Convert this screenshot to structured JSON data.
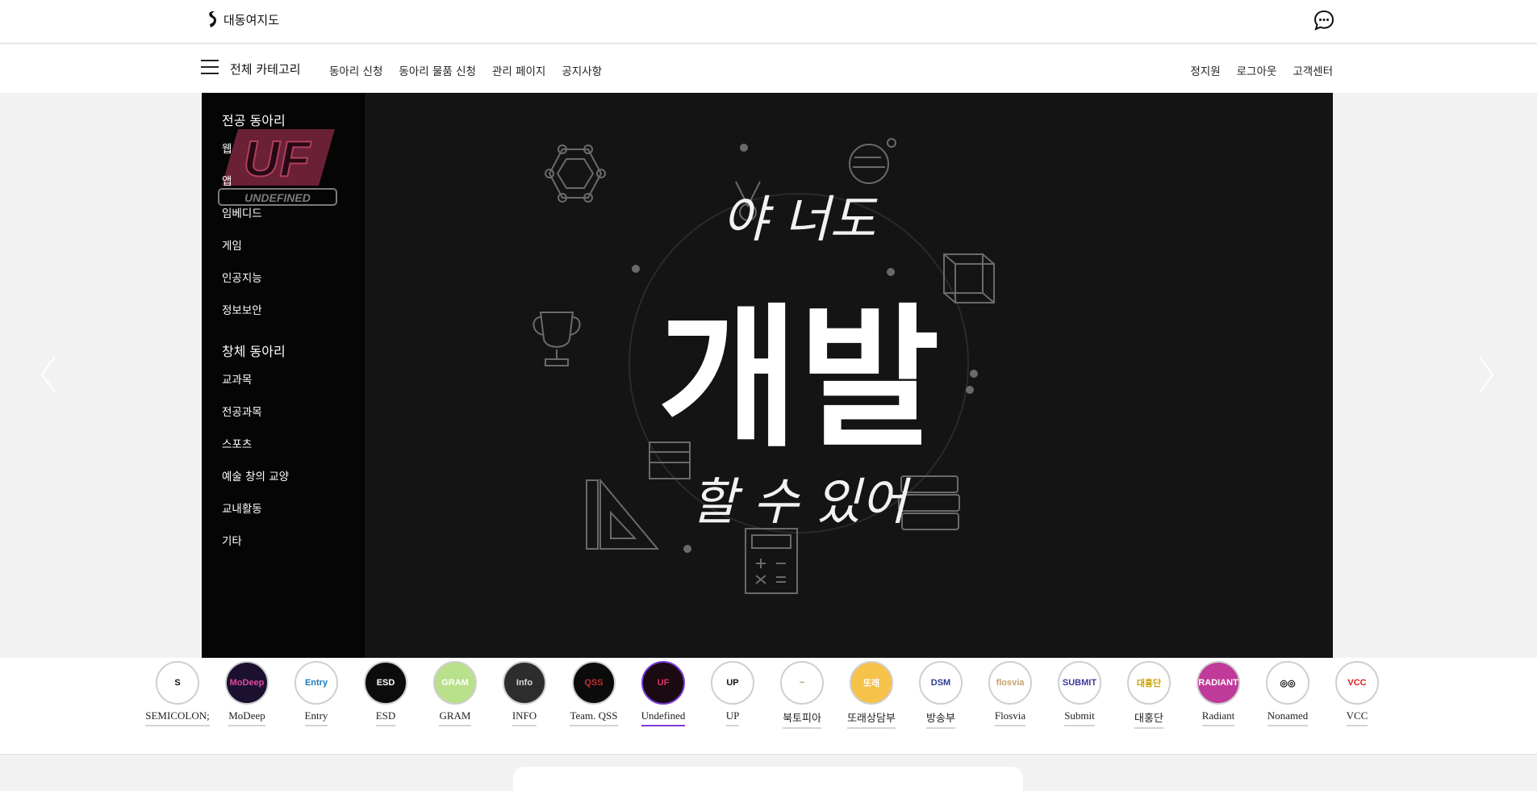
{
  "header": {
    "brand_name": "대동여지도",
    "brand_icon": "brand-logo-icon",
    "chat_icon": "chat-bubble-icon"
  },
  "nav": {
    "all_categories": "전체 카테고리",
    "links": [
      "동아리 신청",
      "동아리 물품 신청",
      "관리 페이지",
      "공지사항"
    ],
    "user_links": [
      "정지원",
      "로그아웃",
      "고객센터"
    ]
  },
  "categories": {
    "major_title": "전공 동아리",
    "major_items": [
      "웹",
      "앱",
      "임베디드",
      "게임",
      "인공지능",
      "정보보안"
    ],
    "creative_title": "창체 동아리",
    "creative_items": [
      "교과목",
      "전공과목",
      "스포츠",
      "예술 창의 교양",
      "교내활동",
      "기타"
    ]
  },
  "hero": {
    "line1": "야 너도",
    "line2": "개발",
    "line3": "할 수 있어",
    "overlay_logo_text": "UNDEFINED"
  },
  "clubs": [
    {
      "name": "SEMICOLON;",
      "bg": "#ffffff",
      "fg": "#111111",
      "mark": "S"
    },
    {
      "name": "MoDeep",
      "bg": "#1b1030",
      "fg": "#e04a9a",
      "mark": "MoDeep"
    },
    {
      "name": "Entry",
      "bg": "#ffffff",
      "fg": "#1a7abf",
      "mark": "Entry"
    },
    {
      "name": "ESD",
      "bg": "#0c0c0c",
      "fg": "#ffffff",
      "mark": "ESD"
    },
    {
      "name": "GRAM",
      "bg": "#b9e08a",
      "fg": "#ffffff",
      "mark": "GRAM"
    },
    {
      "name": "INFO",
      "bg": "#2d2d2d",
      "fg": "#dddddd",
      "mark": "Info"
    },
    {
      "name": "Team. QSS",
      "bg": "#0b0b0b",
      "fg": "#c03030",
      "mark": "QSS"
    },
    {
      "name": "Undefined",
      "bg": "#1a0a12",
      "fg": "#e0306a",
      "mark": "UF",
      "active": true
    },
    {
      "name": "UP",
      "bg": "#ffffff",
      "fg": "#111111",
      "mark": "UP"
    },
    {
      "name": "북토피아",
      "bg": "#ffffff",
      "fg": "#aa9966",
      "mark": "~"
    },
    {
      "name": "또래상담부",
      "bg": "#f6c24a",
      "fg": "#ffffff",
      "mark": "또래"
    },
    {
      "name": "방송부",
      "bg": "#ffffff",
      "fg": "#2a3d8f",
      "mark": "DSM"
    },
    {
      "name": "Flosvia",
      "bg": "#ffffff",
      "fg": "#c8a070",
      "mark": "flosvia"
    },
    {
      "name": "Submit",
      "bg": "#ffffff",
      "fg": "#3a3a9a",
      "mark": "SUBMIT"
    },
    {
      "name": "대홍단",
      "bg": "#ffffff",
      "fg": "#c9a200",
      "mark": "대홍단"
    },
    {
      "name": "Radiant",
      "bg": "#c03a9a",
      "fg": "#ffffff",
      "mark": "RADIANT"
    },
    {
      "name": "Nonamed",
      "bg": "#ffffff",
      "fg": "#111111",
      "mark": "◎◎"
    },
    {
      "name": "VCC",
      "bg": "#ffffff",
      "fg": "#e02020",
      "mark": "VCC"
    }
  ]
}
